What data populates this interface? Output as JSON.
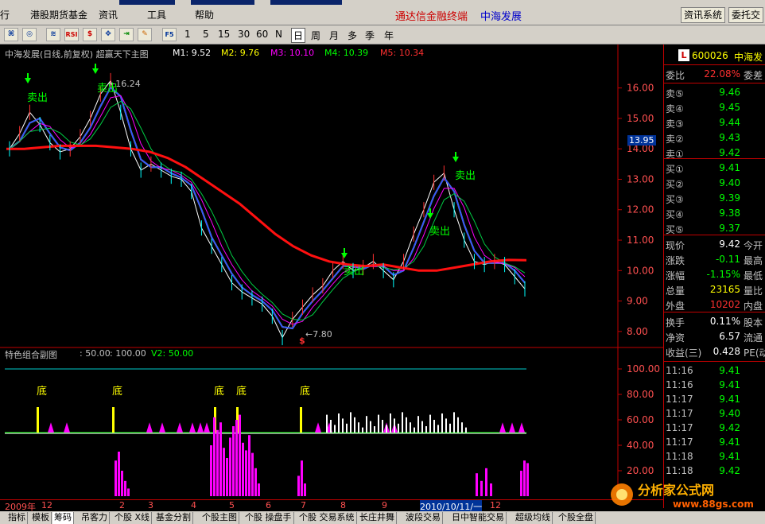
{
  "menubar": {
    "items": [
      "行",
      "港股期货基金",
      "资讯",
      "工具",
      "帮助"
    ],
    "title": "通达信金融终端",
    "stock_name": "中海发展",
    "buttons": [
      "资讯系统",
      "委托交"
    ]
  },
  "toolbar": {
    "icons": [
      "chart-icon",
      "zoom-icon",
      "indicator-icon",
      "rsi-icon",
      "money-icon",
      "move-icon",
      "export-icon",
      "pen-icon",
      "f5-icon"
    ],
    "periods": [
      "1",
      "5",
      "15",
      "30",
      "60",
      "N",
      "日",
      "周",
      "月",
      "多",
      "季",
      "年"
    ],
    "active_period": "日"
  },
  "main_chart": {
    "title": "中海发展(日线,前复权) 超赢天下主图",
    "ma": [
      {
        "label": "M1: 9.52",
        "color": "#ffffff",
        "arrow": "↓"
      },
      {
        "label": "M2: 9.76",
        "color": "#ffff00",
        "arrow": "↓"
      },
      {
        "label": "M3: 10.10",
        "color": "#ff00ff",
        "arrow": "↓"
      },
      {
        "label": "M4: 10.39",
        "color": "#00ff00",
        "arrow": "↓"
      },
      {
        "label": "M5: 10.34",
        "color": "#ff3030",
        "arrow": "↑"
      }
    ],
    "high_label": "←16.24",
    "low_label": "←7.80",
    "current_price_tag": "13.95",
    "sell_label": "卖出",
    "buy_marker": "$"
  },
  "sub_chart": {
    "title": "特色组合副图",
    "params": [
      ": 50.00",
      ": 100.00",
      "V2: 50.00"
    ],
    "bottom_label": "底"
  },
  "chart_data": [
    {
      "type": "line",
      "title": "中海发展(日线,前复权) 超赢天下主图",
      "yticks": [
        "16.00",
        "15.00",
        "14.00",
        "13.00",
        "12.00",
        "11.00",
        "10.00",
        "9.00",
        "8.00"
      ],
      "ylim": [
        7.5,
        16.8
      ],
      "x_labels": [
        "2009年",
        "12",
        "2",
        "3",
        "4",
        "5",
        "6",
        "7",
        "8",
        "9",
        "2010/10/11/一",
        "12"
      ],
      "high": 16.24,
      "low": 7.8,
      "last": 9.42,
      "price_path": [
        14.0,
        14.5,
        15.2,
        14.8,
        14.2,
        13.9,
        14.0,
        14.4,
        15.0,
        15.8,
        16.24,
        15.2,
        14.0,
        13.3,
        13.5,
        13.3,
        13.1,
        13.0,
        12.6,
        11.4,
        10.8,
        10.2,
        9.6,
        9.3,
        9.1,
        8.9,
        8.5,
        7.8,
        8.4,
        8.8,
        9.2,
        9.5,
        10.0,
        10.3,
        10.0,
        10.1,
        10.3,
        10.0,
        9.7,
        10.3,
        11.2,
        12.0,
        12.9,
        13.2,
        12.0,
        11.0,
        10.3,
        10.2,
        10.3,
        10.2,
        9.8,
        9.4
      ],
      "ma_long_path": [
        14.0,
        14.0,
        14.05,
        14.1,
        14.1,
        14.1,
        14.05,
        14.0,
        13.9,
        13.7,
        13.4,
        13.0,
        12.6,
        12.2,
        11.7,
        11.2,
        10.8,
        10.5,
        10.3,
        10.2,
        10.15,
        10.2,
        10.1,
        10.0,
        10.0,
        10.1,
        10.2,
        10.3,
        10.35,
        10.34
      ]
    },
    {
      "type": "bar",
      "title": "特色组合副图",
      "yticks": [
        "100.00",
        "80.00",
        "60.00",
        "40.00",
        "20.00"
      ],
      "ylim": [
        0,
        110
      ],
      "signal_bars": [
        {
          "x": 47,
          "label": "底"
        },
        {
          "x": 142,
          "label": "底"
        },
        {
          "x": 270,
          "label": "底"
        },
        {
          "x": 298,
          "label": "底"
        },
        {
          "x": 378,
          "label": "底"
        }
      ],
      "magenta_bars": [
        [
          144,
          28
        ],
        [
          148,
          35
        ],
        [
          152,
          20
        ],
        [
          156,
          12
        ],
        [
          160,
          6
        ],
        [
          264,
          40
        ],
        [
          268,
          62
        ],
        [
          272,
          52
        ],
        [
          276,
          58
        ],
        [
          280,
          38
        ],
        [
          284,
          30
        ],
        [
          288,
          46
        ],
        [
          292,
          55
        ],
        [
          296,
          60
        ],
        [
          300,
          64
        ],
        [
          304,
          42
        ],
        [
          308,
          36
        ],
        [
          312,
          48
        ],
        [
          316,
          34
        ],
        [
          320,
          22
        ],
        [
          324,
          10
        ],
        [
          374,
          16
        ],
        [
          378,
          28
        ],
        [
          382,
          10
        ],
        [
          598,
          18
        ],
        [
          604,
          12
        ],
        [
          610,
          22
        ],
        [
          616,
          10
        ],
        [
          654,
          20
        ],
        [
          658,
          28
        ],
        [
          662,
          26
        ]
      ]
    }
  ],
  "right_panel": {
    "code": "600026",
    "name": "中海发",
    "logo": "L",
    "ratio": {
      "label": "委比",
      "value": "22.08%",
      "extra": "委差"
    },
    "sells": [
      {
        "label": "卖⑤",
        "price": "9.46"
      },
      {
        "label": "卖④",
        "price": "9.45"
      },
      {
        "label": "卖③",
        "price": "9.44"
      },
      {
        "label": "卖②",
        "price": "9.43"
      },
      {
        "label": "卖①",
        "price": "9.42"
      }
    ],
    "buys": [
      {
        "label": "买①",
        "price": "9.41"
      },
      {
        "label": "买②",
        "price": "9.40"
      },
      {
        "label": "买③",
        "price": "9.39"
      },
      {
        "label": "买④",
        "price": "9.38"
      },
      {
        "label": "买⑤",
        "price": "9.37"
      }
    ],
    "stats": [
      {
        "label": "现价",
        "value": "9.42",
        "extra": "今开",
        "color": "#ffffff"
      },
      {
        "label": "涨跌",
        "value": "-0.11",
        "extra": "最高",
        "color": "#00ff00"
      },
      {
        "label": "涨幅",
        "value": "-1.15%",
        "extra": "最低",
        "color": "#00ff00"
      },
      {
        "label": "总量",
        "value": "23165",
        "extra": "量比",
        "color": "#ffff00"
      },
      {
        "label": "外盘",
        "value": "10202",
        "extra": "内盘",
        "color": "#ff3030"
      }
    ],
    "stats2": [
      {
        "label": "换手",
        "value": "0.11%",
        "extra": "股本"
      },
      {
        "label": "净资",
        "value": "6.57",
        "extra": "流通"
      },
      {
        "label": "收益(三)",
        "value": "0.428",
        "extra": "PE(动"
      }
    ],
    "ticks": [
      {
        "time": "11:16",
        "price": "9.41"
      },
      {
        "time": "11:16",
        "price": "9.41"
      },
      {
        "time": "11:17",
        "price": "9.41"
      },
      {
        "time": "11:17",
        "price": "9.40"
      },
      {
        "time": "11:17",
        "price": "9.42"
      },
      {
        "time": "11:17",
        "price": "9.41"
      },
      {
        "time": "11:18",
        "price": "9.41"
      },
      {
        "time": "11:18",
        "price": "9.42"
      }
    ]
  },
  "tabs": [
    "指标",
    "模板",
    "筹码",
    "吊客力",
    "个股 X线",
    "基金分割",
    "个股主图",
    "个股 操盘手",
    "个股 交易系统",
    "长庄井舞",
    "波段交易",
    "日中智能交易",
    "超级均线",
    "个股全盘"
  ],
  "active_tab": "筹码",
  "watermark": {
    "text": "分析家公式网",
    "url": "www.88gs.com"
  },
  "colors": {
    "up": "#ff3030",
    "down": "#00ffff",
    "axis": "#c00000",
    "magenta": "#ff00ff",
    "yellow": "#ffff00"
  }
}
